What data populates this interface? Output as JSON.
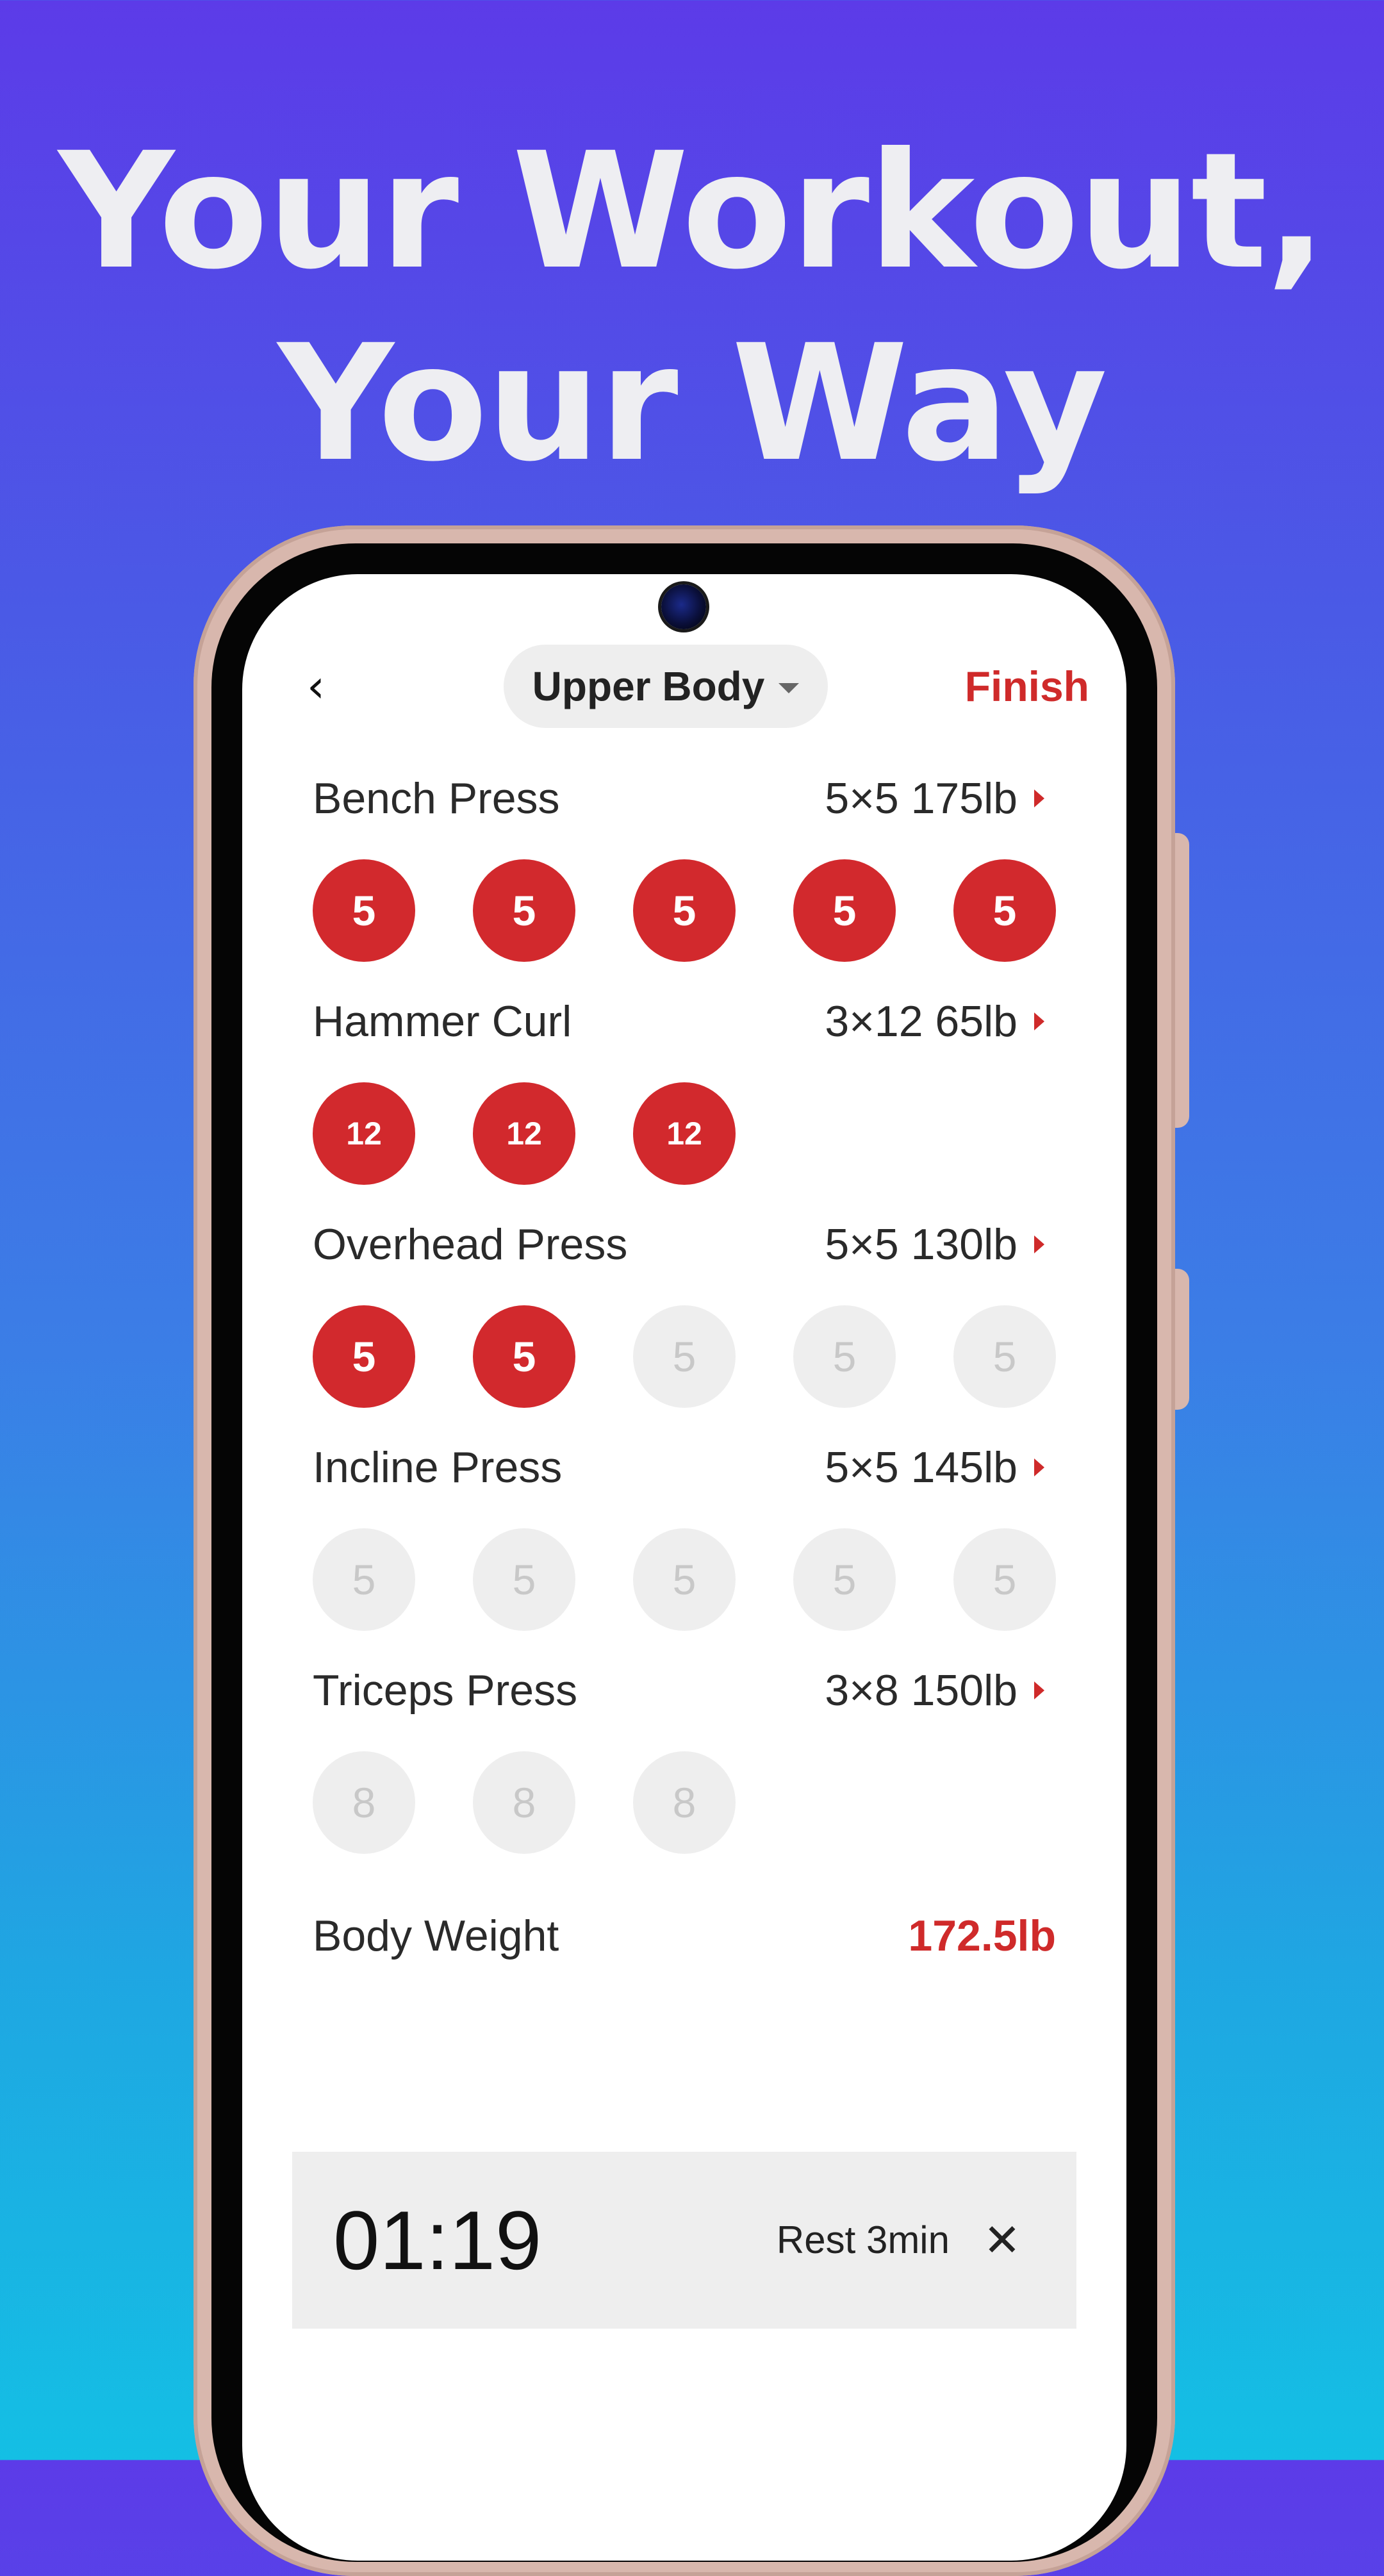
{
  "headline": {
    "line1": "Your Workout,",
    "line2": "Your Way"
  },
  "topbar": {
    "back_icon": "‹",
    "workout_name": "Upper Body",
    "finish_label": "Finish"
  },
  "exercises": [
    {
      "name": "Bench Press",
      "plan": "5×5 175lb",
      "sets": [
        {
          "reps": "5",
          "done": true
        },
        {
          "reps": "5",
          "done": true
        },
        {
          "reps": "5",
          "done": true
        },
        {
          "reps": "5",
          "done": true
        },
        {
          "reps": "5",
          "done": true
        }
      ]
    },
    {
      "name": "Hammer Curl",
      "plan": "3×12 65lb",
      "sets": [
        {
          "reps": "12",
          "done": true
        },
        {
          "reps": "12",
          "done": true
        },
        {
          "reps": "12",
          "done": true
        }
      ]
    },
    {
      "name": "Overhead Press",
      "plan": "5×5 130lb",
      "sets": [
        {
          "reps": "5",
          "done": true
        },
        {
          "reps": "5",
          "done": true
        },
        {
          "reps": "5",
          "done": false
        },
        {
          "reps": "5",
          "done": false
        },
        {
          "reps": "5",
          "done": false
        }
      ]
    },
    {
      "name": "Incline Press",
      "plan": "5×5 145lb",
      "sets": [
        {
          "reps": "5",
          "done": false
        },
        {
          "reps": "5",
          "done": false
        },
        {
          "reps": "5",
          "done": false
        },
        {
          "reps": "5",
          "done": false
        },
        {
          "reps": "5",
          "done": false
        }
      ]
    },
    {
      "name": "Triceps Press",
      "plan": "3×8 150lb",
      "sets": [
        {
          "reps": "8",
          "done": false
        },
        {
          "reps": "8",
          "done": false
        },
        {
          "reps": "8",
          "done": false
        }
      ]
    }
  ],
  "body_weight": {
    "label": "Body Weight",
    "value": "172.5lb"
  },
  "rest_timer": {
    "time": "01:19",
    "rest_label": "Rest 3min",
    "close_icon": "✕"
  },
  "colors": {
    "accent": "#d2292d",
    "pending_set": "#eeeeee",
    "background_top": "#5c3be8",
    "background_bottom": "#14bfe4"
  }
}
